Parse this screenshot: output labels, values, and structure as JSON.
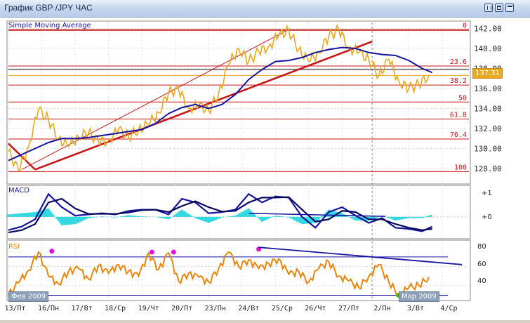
{
  "window": {
    "title": "График GBP /JPY  ЧАС",
    "buttons": [
      "minimize-icon",
      "restore-icon",
      "maximize-icon"
    ]
  },
  "price_panel": {
    "indicator_label": "Simple  Moving  Average",
    "current_price_label": "137.31",
    "fib_labels": [
      "0",
      "23.6",
      "38.2",
      "50",
      "61.8",
      "76.4",
      "100"
    ]
  },
  "macd_panel": {
    "label": "MACD",
    "ticks": [
      "+1",
      "+0"
    ]
  },
  "rsi_panel": {
    "label": "RSI",
    "ticks": [
      "80",
      "60",
      "40"
    ]
  },
  "bottom_tags": {
    "left": "Фев 2009",
    "right": "Мар 2009"
  },
  "colors": {
    "price": "#e8a820",
    "sma": "#1515a0",
    "trend": "#c81414",
    "fib": "#c81414",
    "macd_main": "#1515a0",
    "macd_signal": "#0a0a60",
    "macd_hist": "#35d8e0",
    "rsi": "#e8860c",
    "rsi_overbought": "#e010e0",
    "rsi_oversold": "#10c010",
    "level": "#1515a0"
  },
  "chart_data": [
    {
      "type": "line",
      "title": "GBP /JPY",
      "y_ticks": [
        128.0,
        130.0,
        132.0,
        134.0,
        136.0,
        138.0,
        140.0,
        142.0
      ],
      "ylim": [
        126.6,
        142.6
      ],
      "x_labels": [
        "13/Пт",
        "16/Пн",
        "17/Вт",
        "18/Ср",
        "19/Чт",
        "20/Пт",
        "23/Пн",
        "24/Вт",
        "25/Ср",
        "26/Чт",
        "27/Пт",
        "2/Пн",
        "3/Вт",
        "4/Ср"
      ],
      "xlim": [
        0,
        13.8
      ],
      "fibonacci_retracement": {
        "levels": [
          {
            "label": "0",
            "price": 141.85
          },
          {
            "label": "23.6",
            "price": 138.25
          },
          {
            "label": "38.2",
            "price": 136.35
          },
          {
            "label": "50",
            "price": 134.65
          },
          {
            "label": "61.8",
            "price": 132.95
          },
          {
            "label": "76.4",
            "price": 130.95
          },
          {
            "label": "100",
            "price": 127.7
          }
        ]
      },
      "current_price": 137.31,
      "series": [
        {
          "name": "Simple  Moving  Average",
          "x": [
            0.0,
            0.4,
            0.8,
            1.2,
            1.6,
            2.0,
            2.4,
            2.8,
            3.2,
            3.6,
            4.0,
            4.4,
            4.8,
            5.2,
            5.6,
            6.0,
            6.4,
            6.8,
            7.2,
            7.6,
            8.0,
            8.4,
            8.8,
            9.2,
            9.6,
            10.0,
            10.4,
            10.8,
            11.2,
            11.6,
            12.0,
            12.4,
            12.7
          ],
          "values": [
            128.8,
            129.4,
            130.0,
            130.6,
            131.0,
            131.0,
            131.1,
            131.3,
            131.5,
            131.7,
            131.9,
            132.5,
            133.5,
            134.1,
            134.4,
            134.0,
            134.4,
            135.4,
            136.9,
            137.9,
            138.7,
            138.8,
            139.1,
            139.6,
            139.9,
            140.1,
            140.0,
            139.6,
            139.4,
            139.3,
            138.8,
            138.0,
            137.6
          ]
        },
        {
          "name": "",
          "x": [
            0.0,
            0.3,
            0.6,
            0.9,
            1.2,
            1.5,
            1.8,
            2.1,
            2.4,
            2.7,
            3.0,
            3.3,
            3.6,
            3.9,
            4.2,
            4.5,
            4.8,
            5.1,
            5.4,
            5.7,
            6.0,
            6.3,
            6.6,
            6.9,
            7.2,
            7.5,
            7.8,
            8.1,
            8.4,
            8.7,
            9.0,
            9.3,
            9.6,
            9.9,
            10.2,
            10.5,
            10.8,
            11.1,
            11.4,
            11.7,
            12.0,
            12.3,
            12.6
          ],
          "values": [
            129.7,
            127.8,
            130.2,
            133.9,
            132.9,
            131.0,
            130.2,
            131.2,
            131.6,
            130.7,
            130.8,
            131.9,
            131.2,
            131.9,
            132.4,
            133.6,
            135.6,
            135.9,
            134.0,
            134.3,
            133.8,
            135.5,
            138.4,
            140.0,
            138.7,
            139.7,
            140.2,
            141.3,
            141.8,
            139.9,
            138.7,
            139.6,
            141.2,
            141.9,
            140.1,
            139.6,
            138.9,
            137.3,
            138.9,
            136.7,
            136.0,
            136.4,
            137.3
          ]
        }
      ]
    },
    {
      "type": "line",
      "title": "MACD",
      "y_ticks": [
        1,
        0
      ],
      "ylim": [
        -0.85,
        1.25
      ],
      "series": [
        {
          "name": "",
          "x": [
            0.0,
            0.4,
            0.8,
            1.2,
            1.6,
            2.0,
            2.4,
            2.8,
            3.2,
            3.6,
            4.0,
            4.4,
            4.8,
            5.2,
            5.6,
            6.0,
            6.4,
            6.8,
            7.2,
            7.6,
            8.0,
            8.4,
            8.8,
            9.2,
            9.6,
            10.0,
            10.4,
            10.8,
            11.2,
            11.6,
            12.0,
            12.4,
            12.7
          ],
          "values": [
            -0.55,
            -0.4,
            -0.1,
            0.95,
            0.4,
            0.05,
            0.1,
            0.15,
            0.1,
            0.25,
            0.3,
            0.3,
            0.1,
            0.75,
            0.6,
            0.15,
            0.2,
            0.3,
            0.95,
            0.6,
            0.85,
            0.8,
            0.0,
            -0.45,
            0.2,
            0.4,
            0.05,
            -0.25,
            -0.05,
            -0.45,
            -0.5,
            -0.6,
            -0.4
          ]
        },
        {
          "name": "",
          "x": [
            0.0,
            0.4,
            0.8,
            1.2,
            1.6,
            2.0,
            2.4,
            2.8,
            3.2,
            3.6,
            4.0,
            4.4,
            4.8,
            5.2,
            5.6,
            6.0,
            6.4,
            6.8,
            7.2,
            7.6,
            8.0,
            8.4,
            8.8,
            9.2,
            9.6,
            10.0,
            10.4,
            10.8,
            11.2,
            11.6,
            12.0,
            12.4,
            12.7
          ],
          "values": [
            -0.65,
            -0.55,
            -0.3,
            0.6,
            0.75,
            0.35,
            0.12,
            0.13,
            0.12,
            0.18,
            0.28,
            0.3,
            0.2,
            0.45,
            0.65,
            0.4,
            0.22,
            0.25,
            0.6,
            0.8,
            0.8,
            0.82,
            0.3,
            -0.2,
            -0.1,
            0.25,
            0.2,
            -0.1,
            -0.1,
            -0.3,
            -0.45,
            -0.55,
            -0.5
          ]
        },
        {
          "name": "",
          "x": [
            0.0,
            0.4,
            0.8,
            1.2,
            1.6,
            2.0,
            2.4,
            2.8,
            3.2,
            3.6,
            4.0,
            4.4,
            4.8,
            5.2,
            5.6,
            6.0,
            6.4,
            6.8,
            7.2,
            7.6,
            8.0,
            8.4,
            8.8,
            9.2,
            9.6,
            10.0,
            10.4,
            10.8,
            11.2,
            11.6,
            12.0,
            12.4,
            12.7
          ],
          "values": [
            0.1,
            0.15,
            0.2,
            0.35,
            -0.35,
            -0.3,
            -0.05,
            0.02,
            -0.02,
            0.07,
            0.02,
            0.0,
            -0.1,
            0.3,
            -0.05,
            -0.25,
            -0.02,
            0.05,
            0.35,
            -0.2,
            0.05,
            -0.02,
            -0.3,
            -0.25,
            0.3,
            0.15,
            -0.15,
            -0.15,
            0.05,
            -0.15,
            -0.05,
            -0.05,
            0.1
          ]
        }
      ]
    },
    {
      "type": "line",
      "title": "RSI",
      "y_ticks": [
        80,
        60,
        40
      ],
      "ylim": [
        26,
        86
      ],
      "levels": [
        70,
        30
      ],
      "series": [
        {
          "name": "",
          "x": [
            0.0,
            0.3,
            0.6,
            0.9,
            1.2,
            1.5,
            1.8,
            2.1,
            2.4,
            2.7,
            3.0,
            3.3,
            3.6,
            3.9,
            4.2,
            4.5,
            4.8,
            5.1,
            5.4,
            5.7,
            6.0,
            6.3,
            6.6,
            6.9,
            7.2,
            7.5,
            7.8,
            8.1,
            8.4,
            8.7,
            9.0,
            9.3,
            9.6,
            9.9,
            10.2,
            10.5,
            10.8,
            11.1,
            11.4,
            11.7,
            12.0,
            12.3,
            12.6
          ],
          "values": [
            30,
            43,
            56,
            75,
            50,
            42,
            55,
            58,
            47,
            61,
            53,
            62,
            55,
            50,
            74,
            57,
            74,
            45,
            53,
            49,
            44,
            58,
            75,
            60,
            67,
            58,
            63,
            68,
            52,
            55,
            44,
            58,
            65,
            50,
            45,
            38,
            50,
            62,
            44,
            30,
            38,
            40,
            49
          ]
        }
      ]
    }
  ]
}
